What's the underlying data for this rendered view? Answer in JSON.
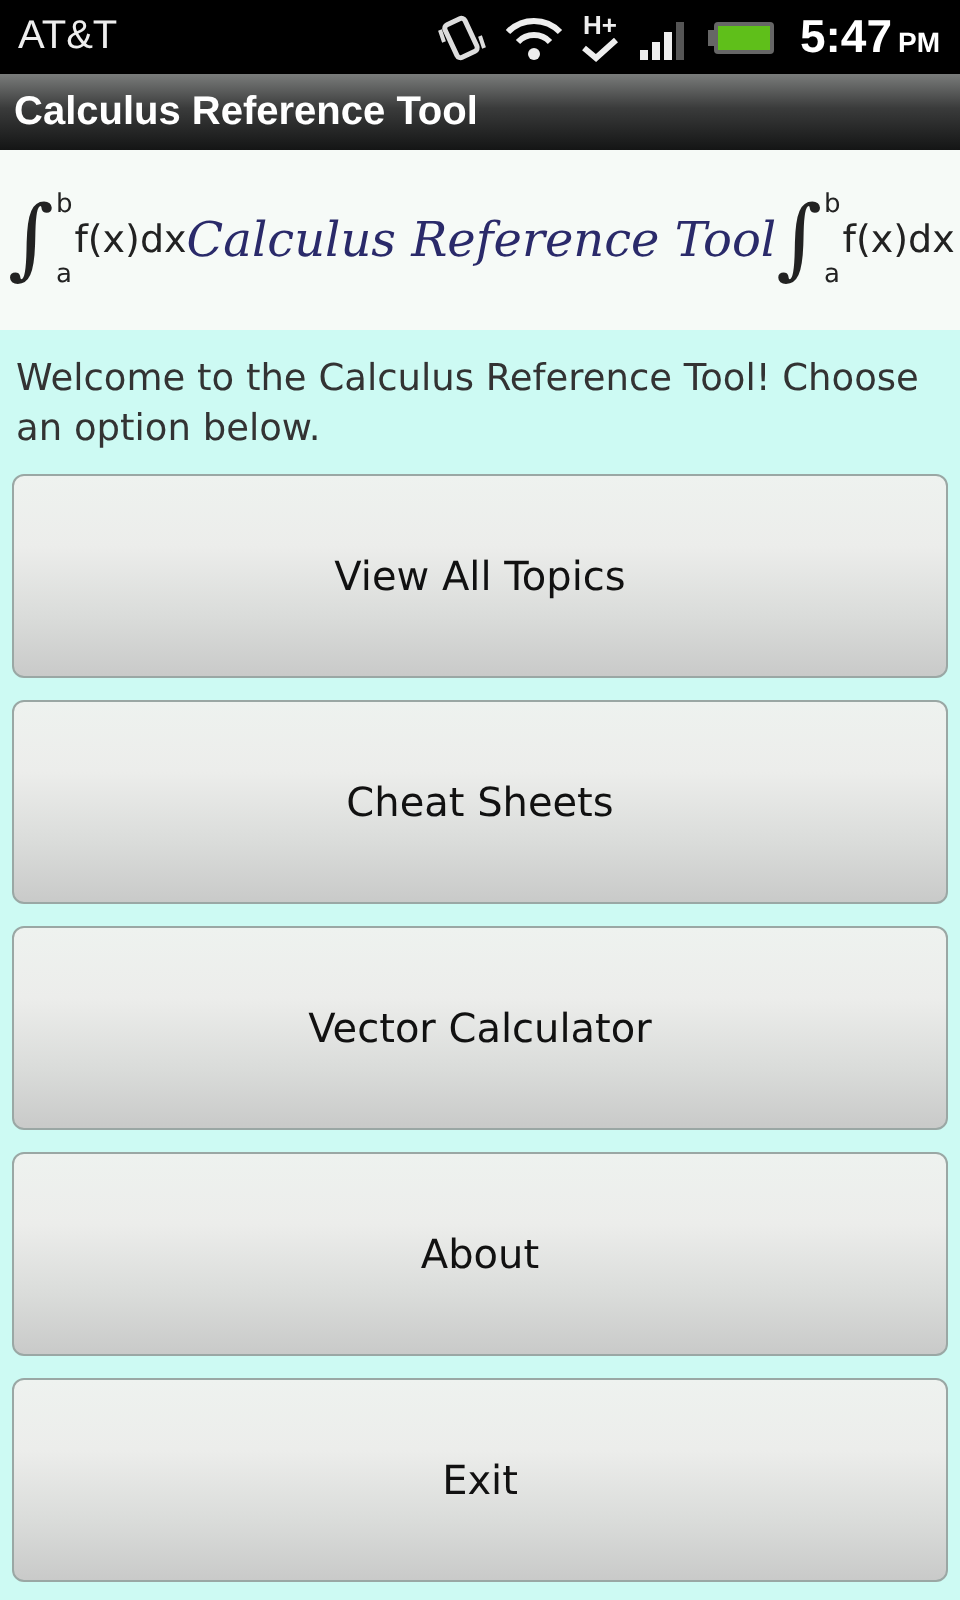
{
  "status_bar": {
    "carrier": "AT&T",
    "network": "H+",
    "time": "5:47",
    "meridiem": "PM"
  },
  "window": {
    "title": "Calculus Reference Tool"
  },
  "banner": {
    "title": "Calculus Reference Tool",
    "formulas": [
      {
        "sign": "∫",
        "upper": "b",
        "lower": "a",
        "integrand": "f(x)dx"
      },
      {
        "sign": "∫",
        "upper": "b",
        "lower": "a",
        "integrand": "f(x)dx"
      }
    ]
  },
  "welcome": "Welcome to the Calculus Reference Tool! Choose an option below.",
  "buttons": [
    "View All Topics",
    "Cheat Sheets",
    "Vector Calculator",
    "About",
    "Exit"
  ]
}
